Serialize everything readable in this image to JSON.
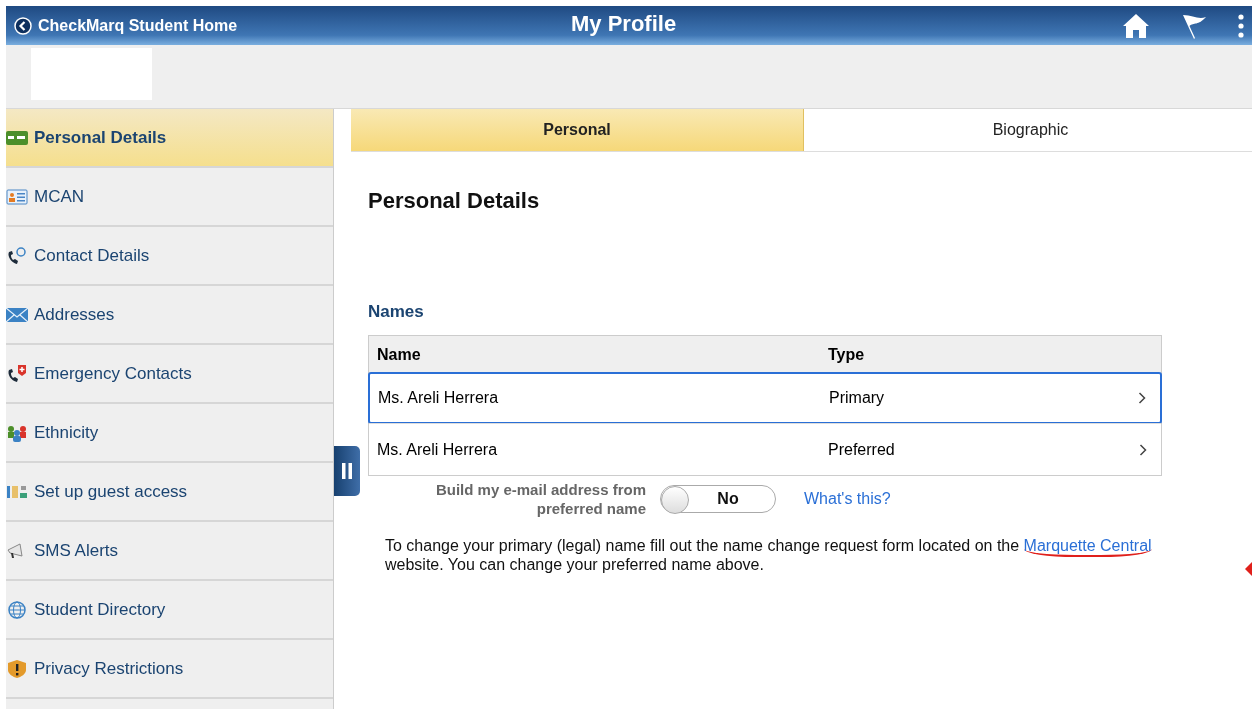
{
  "header": {
    "back_label": "CheckMarq Student Home",
    "title": "My Profile"
  },
  "sidebar": {
    "items": [
      {
        "label": "Personal Details",
        "selected": true
      },
      {
        "label": "MCAN",
        "selected": false
      },
      {
        "label": "Contact Details",
        "selected": false
      },
      {
        "label": "Addresses",
        "selected": false
      },
      {
        "label": "Emergency Contacts",
        "selected": false
      },
      {
        "label": "Ethnicity",
        "selected": false
      },
      {
        "label": "Set up guest access",
        "selected": false
      },
      {
        "label": "SMS Alerts",
        "selected": false
      },
      {
        "label": "Student Directory",
        "selected": false
      },
      {
        "label": "Privacy Restrictions",
        "selected": false
      }
    ]
  },
  "tabs": [
    {
      "label": "Personal",
      "selected": true
    },
    {
      "label": "Biographic",
      "selected": false
    }
  ],
  "page_title": "Personal Details",
  "names": {
    "heading": "Names",
    "columns": [
      "Name",
      "Type"
    ],
    "rows": [
      {
        "name": "Ms. Areli Herrera",
        "type": "Primary",
        "selected": true
      },
      {
        "name": "Ms. Areli Herrera",
        "type": "Preferred",
        "selected": false
      }
    ]
  },
  "email_option": {
    "label": "Build my e-mail address from preferred name",
    "on": false,
    "value": "No",
    "help_link": "What's this?"
  },
  "note": {
    "text": "To change your primary (legal) name fill out the name change request form located on the",
    "link": "Marquette Central",
    "text_after": "website. You can change your preferred name above."
  }
}
